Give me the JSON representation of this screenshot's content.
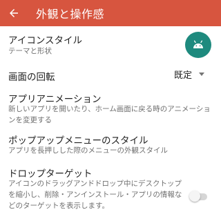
{
  "appbar": {
    "title": "外観と操作感",
    "back_icon": "arrow-left-icon",
    "color": "#d7553f"
  },
  "settings": {
    "icon_style": {
      "title": "アイコンスタイル",
      "subtitle": "テーマと形状",
      "icon": "android-icon",
      "icon_bg": "#1e8a7e"
    },
    "rotation": {
      "title": "画面の回転",
      "value": "既定"
    },
    "app_animation": {
      "title": "アプリアニメーション",
      "subtitle": "新しいアプリを開いたり、ホーム画面に戻る時のアニメーションを変更する"
    },
    "popup_menu_style": {
      "title": "ポップアップメニューのスタイル",
      "subtitle": "アプリを長押しした際のメニューの外観スタイル"
    },
    "drop_target": {
      "title": "ドロップターゲット",
      "subtitle": "アイコンのドラッグアンドドロップ中にデスクトップを縮小し、削除・アンインストール・アプリの情報などのターゲットを表示します。",
      "enabled": false
    }
  }
}
